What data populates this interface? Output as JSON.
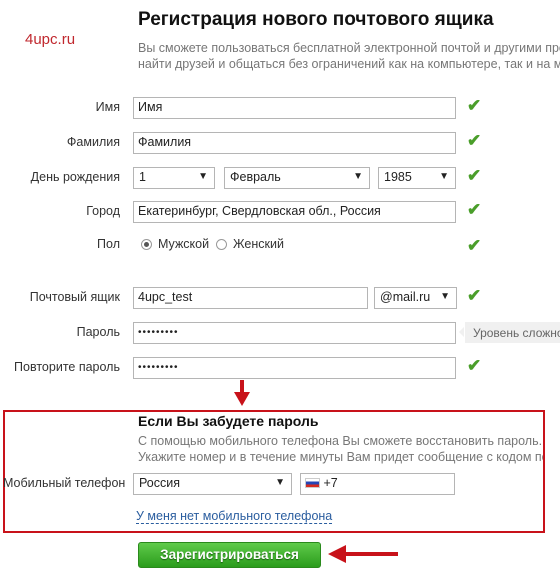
{
  "watermark": "4upc.ru",
  "title": "Регистрация нового почтового ящика",
  "description": [
    "Вы сможете пользоваться бесплатной электронной почтой и другими про",
    "найти друзей и общаться без ограничений как на компьютере, так и на мо"
  ],
  "form": {
    "first_name": {
      "label": "Имя",
      "value": "Имя"
    },
    "last_name": {
      "label": "Фамилия",
      "value": "Фамилия"
    },
    "birthday": {
      "label": "День рождения",
      "day": "1",
      "month": "Февраль",
      "year": "1985"
    },
    "city": {
      "label": "Город",
      "value": "Екатеринбург, Свердловская обл., Россия"
    },
    "gender": {
      "label": "Пол",
      "options": [
        "Мужской",
        "Женский"
      ],
      "selected": "Мужской"
    },
    "mailbox": {
      "label": "Почтовый ящик",
      "value": "4upc_test",
      "domain": "@mail.ru"
    },
    "password": {
      "label": "Пароль",
      "value": "•••••••••",
      "strength_hint": "Уровень сложности"
    },
    "password_repeat": {
      "label": "Повторите пароль",
      "value": "•••••••••"
    }
  },
  "recovery": {
    "heading": "Если Вы забудете пароль",
    "text": [
      "С помощью мобильного телефона Вы сможете восстановить пароль.",
      "Укажите номер и в течение минуты Вам придет сообщение с кодом подтв"
    ],
    "phone_label": "Мобильный телефон",
    "country": "Россия",
    "phone_prefix": "+7",
    "no_phone_link": "У меня нет мобильного телефона"
  },
  "submit_label": "Зарегистрироваться",
  "colors": {
    "accent_red": "#c8121a",
    "check_green": "#4a9e2a",
    "button_green": "#3bb32a"
  }
}
